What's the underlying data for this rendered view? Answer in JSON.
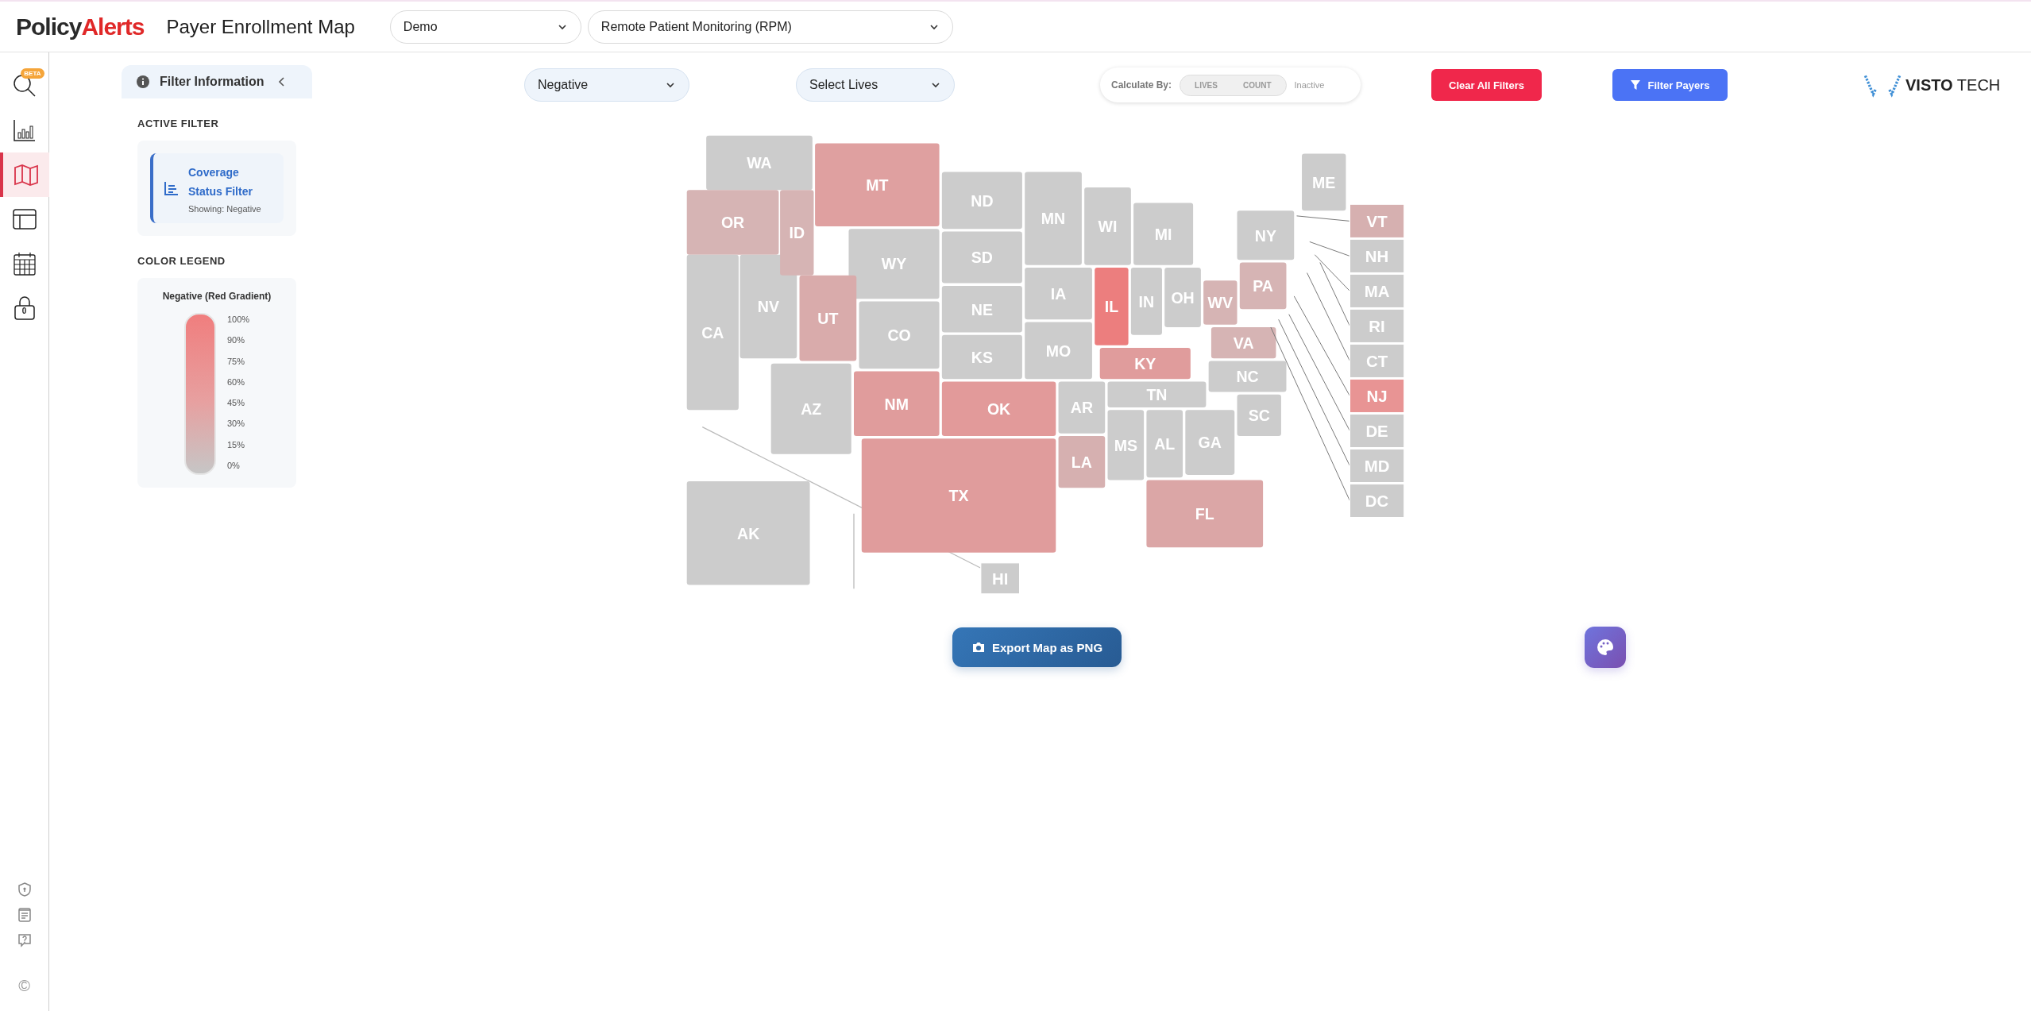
{
  "header": {
    "logo": {
      "dark": "Policy",
      "accent": "Alerts"
    },
    "title": "Payer Enrollment Map",
    "selects": [
      {
        "value": "Demo"
      },
      {
        "value": "Remote Patient Monitoring (RPM)"
      }
    ]
  },
  "rail": {
    "badge": "BETA",
    "lock_count": "0",
    "items": [
      {
        "kind": "search",
        "selected": false
      },
      {
        "kind": "chart",
        "selected": false
      },
      {
        "kind": "map",
        "selected": true
      },
      {
        "kind": "layout",
        "selected": false
      },
      {
        "kind": "calendar",
        "selected": false
      },
      {
        "kind": "lock",
        "selected": false
      }
    ],
    "bottom": [
      {
        "kind": "shield"
      },
      {
        "kind": "doc"
      },
      {
        "kind": "help"
      },
      {
        "kind": "copyright",
        "glyph": "©"
      }
    ]
  },
  "filter_panel": {
    "title": "Filter Information",
    "active_heading": "ACTIVE FILTER",
    "active_filter": {
      "name": "Coverage Status Filter",
      "showing": "Showing: Negative"
    },
    "legend_heading": "COLOR LEGEND",
    "legend": {
      "title": "Negative (Red Gradient)",
      "ticks": [
        "100%",
        "90%",
        "75%",
        "60%",
        "45%",
        "30%",
        "15%",
        "0%"
      ]
    }
  },
  "controls": {
    "status_select": {
      "value": "Negative"
    },
    "lives_select": {
      "value": "Select Lives"
    },
    "calculate": {
      "label": "Calculate By:",
      "options": [
        {
          "label": "LIVES",
          "selected": false
        },
        {
          "label": "COUNT",
          "selected": false
        }
      ],
      "status": "Inactive"
    },
    "clear_button": "Clear All Filters",
    "filter_button": "Filter Payers",
    "brand": {
      "bold": "VISTO",
      "light": "TECH"
    }
  },
  "map": {
    "states": [
      {
        "abbr": "WA",
        "color": "#cccccc"
      },
      {
        "abbr": "OR",
        "color": "#d6b4b4"
      },
      {
        "abbr": "CA",
        "color": "#cccccc"
      },
      {
        "abbr": "NV",
        "color": "#cccccc"
      },
      {
        "abbr": "ID",
        "color": "#d6b4b4"
      },
      {
        "abbr": "MT",
        "color": "#dfa0a0"
      },
      {
        "abbr": "WY",
        "color": "#cccccc"
      },
      {
        "abbr": "UT",
        "color": "#d9abab"
      },
      {
        "abbr": "CO",
        "color": "#cccccc"
      },
      {
        "abbr": "AZ",
        "color": "#cccccc"
      },
      {
        "abbr": "NM",
        "color": "#e09c9c"
      },
      {
        "abbr": "ND",
        "color": "#cccccc"
      },
      {
        "abbr": "SD",
        "color": "#cccccc"
      },
      {
        "abbr": "NE",
        "color": "#cccccc"
      },
      {
        "abbr": "KS",
        "color": "#cccccc"
      },
      {
        "abbr": "OK",
        "color": "#e29a9a"
      },
      {
        "abbr": "TX",
        "color": "#e09c9c"
      },
      {
        "abbr": "MN",
        "color": "#cccccc"
      },
      {
        "abbr": "IA",
        "color": "#cccccc"
      },
      {
        "abbr": "MO",
        "color": "#cccccc"
      },
      {
        "abbr": "AR",
        "color": "#cccccc"
      },
      {
        "abbr": "LA",
        "color": "#d6b0b0"
      },
      {
        "abbr": "WI",
        "color": "#cccccc"
      },
      {
        "abbr": "IL",
        "color": "#ec7e7e"
      },
      {
        "abbr": "MI",
        "color": "#cccccc"
      },
      {
        "abbr": "IN",
        "color": "#cccccc"
      },
      {
        "abbr": "OH",
        "color": "#cccccc"
      },
      {
        "abbr": "KY",
        "color": "#e09c9c"
      },
      {
        "abbr": "TN",
        "color": "#cccccc"
      },
      {
        "abbr": "MS",
        "color": "#cccccc"
      },
      {
        "abbr": "AL",
        "color": "#cccccc"
      },
      {
        "abbr": "GA",
        "color": "#cccccc"
      },
      {
        "abbr": "FL",
        "color": "#dba6a6"
      },
      {
        "abbr": "SC",
        "color": "#cccccc"
      },
      {
        "abbr": "NC",
        "color": "#cccccc"
      },
      {
        "abbr": "VA",
        "color": "#d6b4b4"
      },
      {
        "abbr": "WV",
        "color": "#d6b4b4"
      },
      {
        "abbr": "NY",
        "color": "#cccccc"
      },
      {
        "abbr": "PA",
        "color": "#d6b4b4"
      },
      {
        "abbr": "ME",
        "color": "#cccccc"
      },
      {
        "abbr": "AK",
        "color": "#cccccc"
      }
    ],
    "boxes": [
      {
        "abbr": "VT",
        "color": "#d6b0b0"
      },
      {
        "abbr": "NH",
        "color": "#cccccc"
      },
      {
        "abbr": "MA",
        "color": "#cccccc"
      },
      {
        "abbr": "RI",
        "color": "#cccccc"
      },
      {
        "abbr": "CT",
        "color": "#cccccc"
      },
      {
        "abbr": "NJ",
        "color": "#e89494"
      },
      {
        "abbr": "DE",
        "color": "#cccccc"
      },
      {
        "abbr": "MD",
        "color": "#cccccc"
      },
      {
        "abbr": "DC",
        "color": "#cccccc"
      },
      {
        "abbr": "HI",
        "color": "#cccccc"
      }
    ]
  },
  "export_button": "Export Map as PNG"
}
